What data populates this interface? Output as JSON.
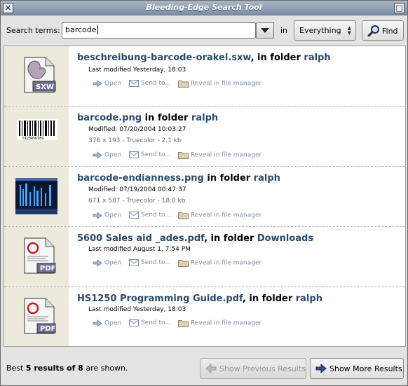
{
  "window": {
    "title": "Bleeding-Edge Search Tool",
    "close_icon": "close-icon",
    "maximize_icon": "maximize-icon"
  },
  "toolbar": {
    "search_label": "Search terms:",
    "search_value": "barcode",
    "in_label": "in",
    "scope_value": "Everything",
    "find_label": "Find"
  },
  "actions": {
    "open": "Open",
    "send": "Send to...",
    "reveal": "Reveal in file manager"
  },
  "results": [
    {
      "name": "beschreibung-barcode-orakel.sxw",
      "sep": ", in folder ",
      "folder": "ralph",
      "modified": "Last modified Yesterday, 18:03",
      "meta": "",
      "icon": "sxw-document-icon"
    },
    {
      "name": "barcode.png",
      "sep": " in folder ",
      "folder": "ralph",
      "modified": "Modified: 07/20/2004 10:03:27",
      "meta": "376 x 193 - Truecolor - 2.1 kb",
      "icon": "barcode-thumbnail"
    },
    {
      "name": "barcode-endianness.png",
      "sep": " in folder ",
      "folder": "ralph",
      "modified": "Modified: 07/19/2004 00:47:37",
      "meta": "671 x 587 - Truecolor - 18.0 kb",
      "icon": "screenshot-thumbnail"
    },
    {
      "name": "5600 Sales aid _ades.pdf",
      "sep": ", in folder ",
      "folder": "Downloads",
      "modified": "Last modified August 1, 7:54 PM",
      "meta": "",
      "icon": "pdf-document-icon"
    },
    {
      "name": "HS1250 Programming Guide.pdf",
      "sep": ", in folder ",
      "folder": "ralph",
      "modified": "Last modified Yesterday, 18:03",
      "meta": "",
      "icon": "pdf-document-icon"
    }
  ],
  "status": {
    "prefix": "Best ",
    "bold": "5 results of 8",
    "suffix": " are shown.",
    "prev_label": "Show Previous Results",
    "more_label": "Show More Results"
  },
  "colors": {
    "title_bar": "#7d8ea6",
    "link": "#2c4a6b",
    "thumb_column": "#ecebdb",
    "action_text": "#7c8ea3"
  }
}
